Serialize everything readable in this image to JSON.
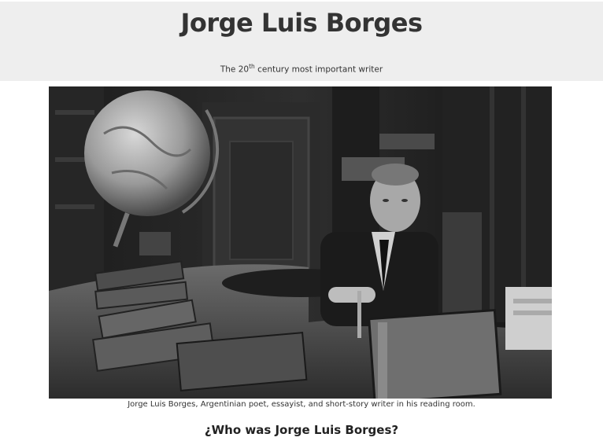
{
  "header": {
    "title": "Jorge Luis Borges",
    "subtitle_prefix": "The 20",
    "subtitle_sup": "th",
    "subtitle_suffix": " century most important writer"
  },
  "figure": {
    "caption": "Jorge Luis Borges, Argentinian poet, essayist, and short-story writer in his reading room."
  },
  "section": {
    "heading": "¿Who was Jorge Luis Borges?"
  }
}
